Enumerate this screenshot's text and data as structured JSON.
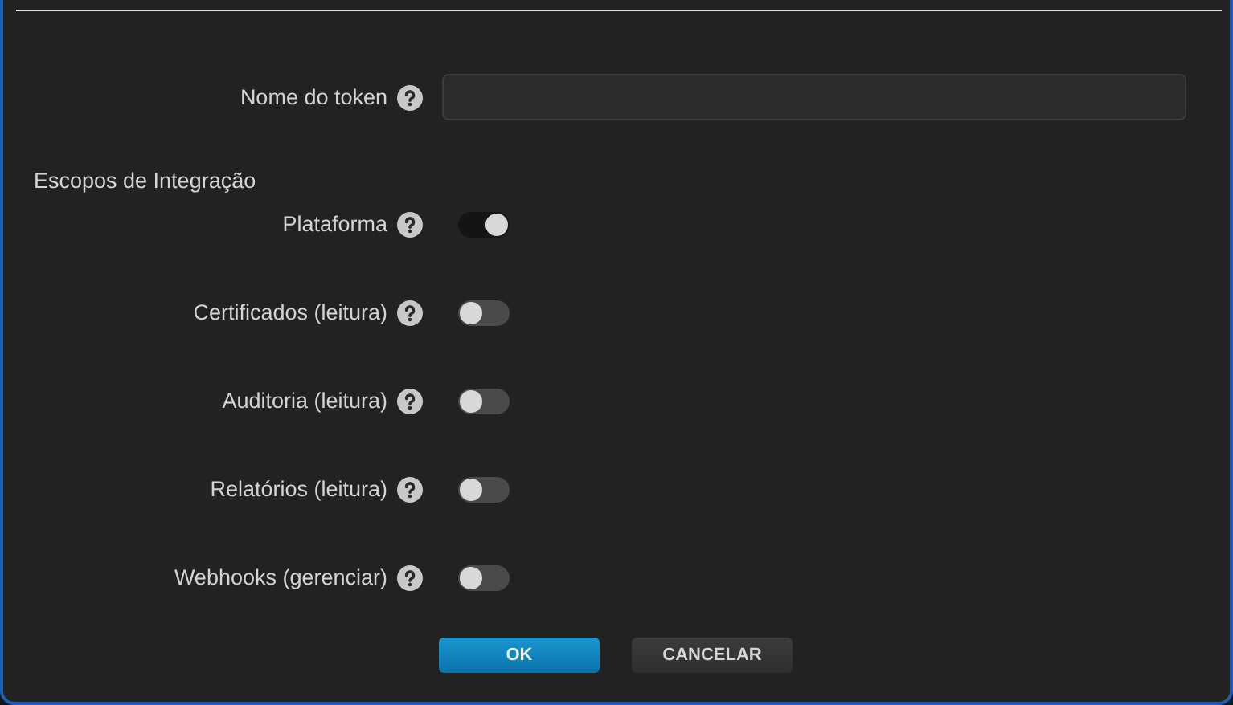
{
  "token_name": {
    "label": "Nome do token"
  },
  "section": "Escopos de Integração",
  "scopes": [
    {
      "label": "Plataforma",
      "on": true
    },
    {
      "label": "Certificados (leitura)",
      "on": false
    },
    {
      "label": "Auditoria (leitura)",
      "on": false
    },
    {
      "label": "Relatórios (leitura)",
      "on": false
    },
    {
      "label": "Webhooks (gerenciar)",
      "on": false
    }
  ],
  "buttons": [
    {
      "label": "OK",
      "kind": "primary"
    },
    {
      "label": "CANCELAR",
      "kind": "secondary"
    }
  ]
}
